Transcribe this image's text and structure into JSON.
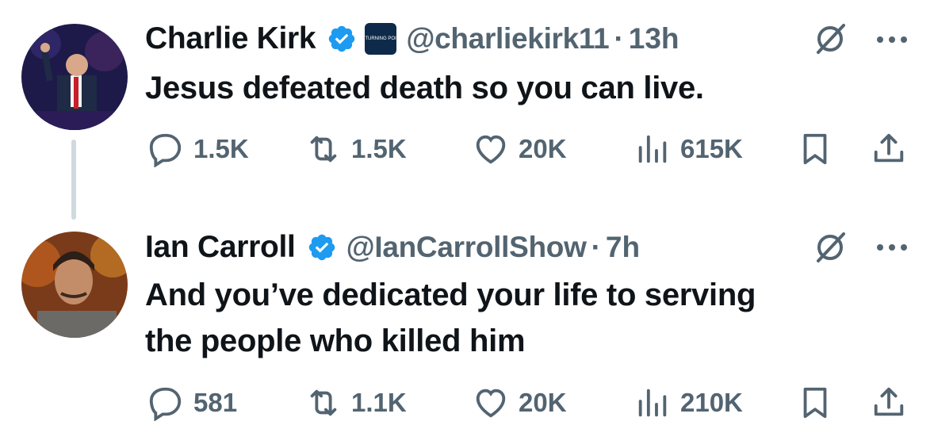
{
  "tweets": [
    {
      "name": "Charlie Kirk",
      "verified": true,
      "org_badge": "TURNING POINT USA",
      "handle": "@charliekirk11",
      "separator": "·",
      "time": "13h",
      "text": "Jesus defeated death so you can live.",
      "actions": {
        "replies": "1.5K",
        "reposts": "1.5K",
        "likes": "20K",
        "views": "615K"
      }
    },
    {
      "name": "Ian Carroll",
      "verified": true,
      "handle": "@IanCarrollShow",
      "separator": "·",
      "time": "7h",
      "text_line1": "And you’ve dedicated your life to serving",
      "text_line2": "the people who killed him",
      "actions": {
        "replies": "581",
        "reposts": "1.1K",
        "likes": "20K",
        "views": "210K"
      }
    }
  ],
  "icons": [
    "verified-badge-icon",
    "grok-icon",
    "more-icon",
    "reply-icon",
    "repost-icon",
    "like-icon",
    "views-icon",
    "bookmark-icon",
    "share-icon"
  ],
  "colors": {
    "text": "#0f1419",
    "secondary": "#536471",
    "verified": "#1d9bf0",
    "thread_line": "#cfd9de"
  }
}
